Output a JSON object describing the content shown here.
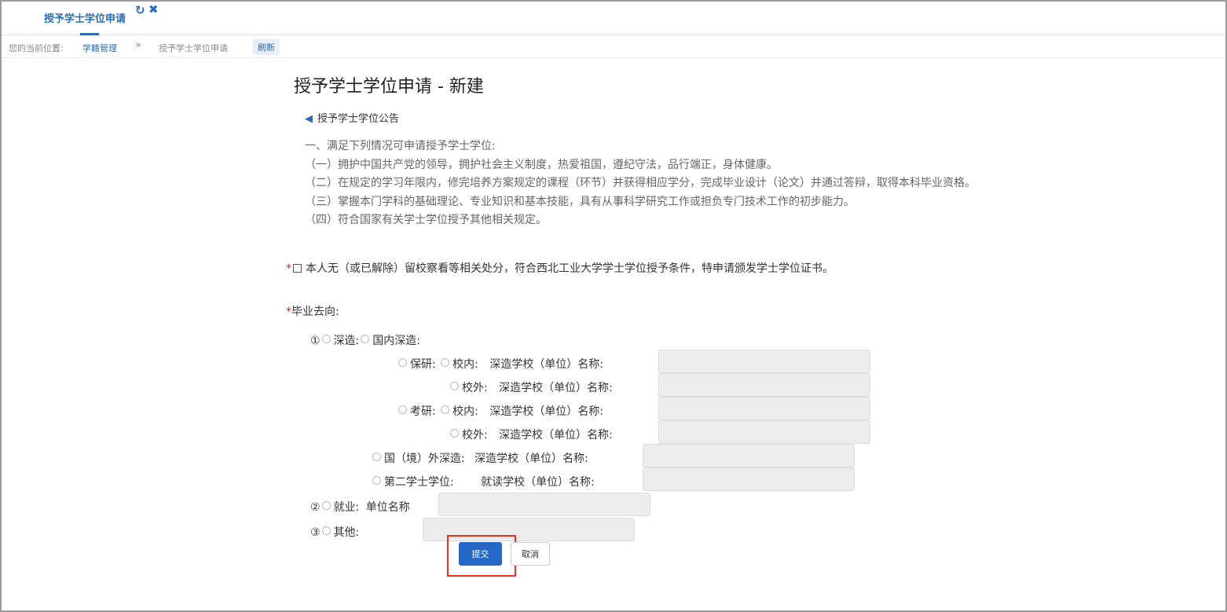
{
  "tab": {
    "title": "授予学士学位申请",
    "refresh_icon": "↻",
    "close_icon": "✖"
  },
  "breadcrumb": {
    "label": "您的当前位置:",
    "item1": "学籍管理",
    "sep": "»",
    "item2": "授予学士学位申请",
    "refresh": "刷新"
  },
  "page_title": "授予学士学位申请 - 新建",
  "notice": {
    "horn_icon": "📢",
    "heading": "授予学士学位公告",
    "lines": [
      "一、满足下列情况可申请授予学士学位:",
      "（一）拥护中国共产党的领导，拥护社会主义制度，热爱祖国，遵纪守法，品行端正，身体健康。",
      "（二）在规定的学习年限内，修完培养方案规定的课程（环节）并获得相应学分，完成毕业设计（论文）并通过答辩，取得本科毕业资格。",
      "（三）掌握本门学科的基础理论、专业知识和基本技能，具有从事科学研究工作或担负专门技术工作的初步能力。",
      "（四）符合国家有关学士学位授予其他相关规定。"
    ]
  },
  "pledge": {
    "required": "*",
    "text": "本人无（或已解除）留校察看等相关处分，符合西北工业大学学士学位授予条件，特申请颁发学士学位证书。"
  },
  "destination": {
    "required": "*",
    "label": "毕业去向:",
    "further_study": {
      "num": "①",
      "label": "深造:",
      "domestic": "国内深造:"
    },
    "baoyan": {
      "label": "保研:",
      "inner": "校内:",
      "outer": "校外:",
      "school_label": "深造学校（单位）名称:"
    },
    "kaoyan": {
      "label": "考研:",
      "inner": "校内:",
      "outer": "校外:",
      "school_label": "深造学校（单位）名称:"
    },
    "abroad": {
      "label": "国（境）外深造:",
      "school_label": "深造学校（单位）名称:"
    },
    "second_degree": {
      "label": "第二学士学位:",
      "school_label": "就读学校（单位）名称:"
    },
    "employment": {
      "num": "②",
      "label": "就业:",
      "unit_label": "单位名称"
    },
    "other": {
      "num": "③",
      "label": "其他:"
    }
  },
  "buttons": {
    "submit": "提交",
    "cancel": "取消"
  },
  "colors": {
    "accent": "#2467c5",
    "required": "#d9211b",
    "highlight": "#e8321f"
  }
}
